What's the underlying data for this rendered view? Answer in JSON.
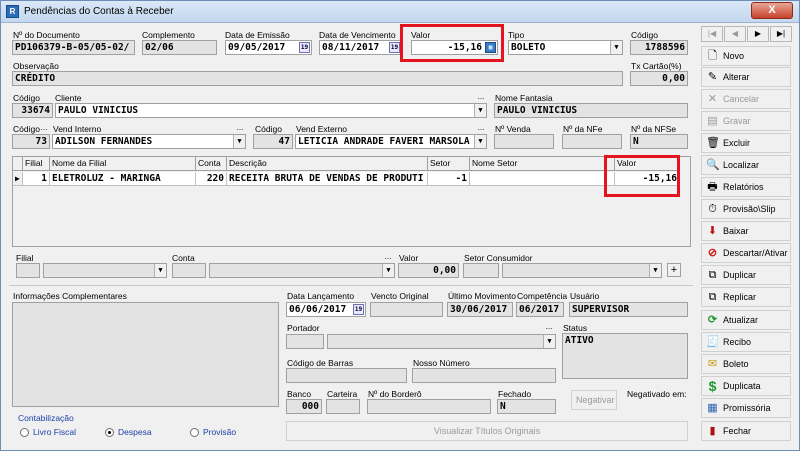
{
  "window": {
    "title": "Pendências do Contas à Receber",
    "app_icon": "R",
    "close": "X"
  },
  "nav": {
    "first": "|◀",
    "prev": "◀",
    "next": "▶",
    "last": "▶|"
  },
  "header": {
    "doc_label": "Nº do Documento",
    "doc_value": "PD106379-B-05/05-02/",
    "complemento_label": "Complemento",
    "complemento_value": "02/06",
    "emissao_label": "Data de Emissão",
    "emissao_value": "09/05/2017",
    "vencimento_label": "Data de Vencimento",
    "vencimento_value": "08/11/2017",
    "valor_label": "Valor",
    "valor_value": "-15,16",
    "tipo_label": "Tipo",
    "tipo_value": "BOLETO",
    "codigo_label": "Código",
    "codigo_value": "1788596",
    "obs_label": "Observação",
    "obs_value": "CRÉDITO",
    "tx_label": "Tx Cartão(%)",
    "tx_value": "0,00"
  },
  "cliente": {
    "codigo_label": "Código",
    "codigo_value": "33674",
    "cliente_label": "Cliente",
    "cliente_value": "PAULO VINICIUS",
    "fantasia_label": "Nome Fantasia",
    "fantasia_value": "PAULO VINICIUS"
  },
  "vendedor": {
    "codigo_label": "Código",
    "codigo_value": "73",
    "interno_label": "Vend Interno",
    "interno_value": "ADILSON FERNANDES",
    "codigo2_label": "Código",
    "codigo2_value": "47",
    "externo_label": "Vend Externo",
    "externo_value": "LETICIA ANDRADE FAVERI MARSOLA",
    "nvenda_label": "Nº Venda",
    "nnfe_label": "Nº da NFe",
    "nfse_label": "Nº da NFSe",
    "nfse_value": "N"
  },
  "grid": {
    "headers": [
      "Filial",
      "Nome da Filial",
      "Conta",
      "Descrição",
      "Setor",
      "Nome Setor",
      "Valor"
    ],
    "row": {
      "indicator": "▶",
      "filial": "1",
      "nome": "ELETROLUZ - MARINGA",
      "conta": "220",
      "descricao": "RECEITA BRUTA DE VENDAS DE PRODUTI",
      "setor": "-1",
      "nome_setor": "",
      "valor": "-15,16"
    }
  },
  "rateio": {
    "filial_label": "Filial",
    "conta_label": "Conta",
    "valor_label": "Valor",
    "valor_value": "0,00",
    "setor_label": "Setor Consumidor",
    "add": "+"
  },
  "info": {
    "label": "Informações Complementares"
  },
  "dates": {
    "lanc_label": "Data Lançamento",
    "lanc_value": "06/06/2017",
    "venc_orig_label": "Vencto Original",
    "ult_mov_label": "Último Movimento",
    "ult_mov_value": "30/06/2017",
    "comp_label": "Competência",
    "comp_value": "06/2017",
    "usuario_label": "Usuário",
    "usuario_value": "SUPERVISOR",
    "portador_label": "Portador",
    "status_label": "Status",
    "status_value": "ATIVO",
    "barras_label": "Código de Barras",
    "nosso_label": "Nosso Número",
    "banco_label": "Banco",
    "banco_value": "000",
    "carteira_label": "Carteira",
    "bordero_label": "Nº do Borderô",
    "fechado_label": "Fechado",
    "fechado_value": "N",
    "negativar": "Negativar",
    "negativado_label": "Negativado em:"
  },
  "contab": {
    "label": "Contabilização",
    "opt1": "Livro Fiscal",
    "opt2": "Despesa",
    "opt3": "Provisão"
  },
  "visualizar": "Visualizar Títulos Originais",
  "sidebar": [
    {
      "label": "Novo",
      "icon": "new-doc-icon",
      "glyph": "🗋"
    },
    {
      "label": "Alterar",
      "icon": "edit-icon",
      "glyph": "✎"
    },
    {
      "label": "Cancelar",
      "icon": "cancel-icon",
      "glyph": "✕"
    },
    {
      "label": "Gravar",
      "icon": "save-icon",
      "glyph": "▤"
    },
    {
      "label": "Excluir",
      "icon": "trash-icon",
      "glyph": "🗑"
    },
    {
      "label": "Localizar",
      "icon": "search-icon",
      "glyph": "🔍"
    },
    {
      "label": "Relatórios",
      "icon": "printer-icon",
      "glyph": "🖶"
    },
    {
      "label": "Provisão\\Slip",
      "icon": "clock-icon",
      "glyph": "⏱"
    },
    {
      "label": "Baixar",
      "icon": "down-arrow-icon",
      "glyph": "⬇"
    },
    {
      "label": "Descartar/Ativar",
      "icon": "no-entry-icon",
      "glyph": "⊘"
    },
    {
      "label": "Duplicar",
      "icon": "duplicate-icon",
      "glyph": "⧉"
    },
    {
      "label": "Replicar",
      "icon": "replicate-icon",
      "glyph": "⧉"
    },
    {
      "label": "Atualizar",
      "icon": "refresh-icon",
      "glyph": "⟳"
    },
    {
      "label": "Recibo",
      "icon": "receipt-icon",
      "glyph": "🧾"
    },
    {
      "label": "Boleto",
      "icon": "envelope-icon",
      "glyph": "✉"
    },
    {
      "label": "Duplicata",
      "icon": "dollar-icon",
      "glyph": "$"
    },
    {
      "label": "Promissória",
      "icon": "promissory-icon",
      "glyph": "▦"
    },
    {
      "label": "Fechar",
      "icon": "exit-door-icon",
      "glyph": "▮"
    }
  ],
  "colors": {
    "highlight": "#e4141e",
    "titlebar": "#c3d7ef"
  }
}
